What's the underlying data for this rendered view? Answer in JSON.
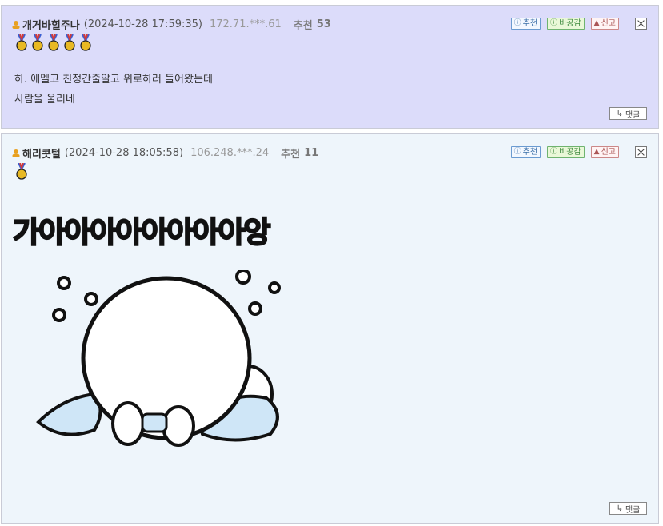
{
  "comments": [
    {
      "nickname": "개거바힐주나",
      "date": "(2024-10-28 17:59:35)",
      "ip": "172.71.***.61",
      "recommend_label": "추천",
      "recommend_count": "53",
      "medal_count": 5,
      "lines": [
        "하. 애멜고 친정간줄알고 위로하러 들어왔는데",
        "사람을 울리네"
      ],
      "buttons": {
        "recommend": "추천",
        "nonrecommend": "비공감",
        "report": "신고"
      },
      "reply_label": "댓글"
    },
    {
      "nickname": "해리콧털",
      "date": "(2024-10-28 18:05:58)",
      "ip": "106.248.***.24",
      "recommend_label": "추천",
      "recommend_count": "11",
      "medal_count": 1,
      "shout_text": "가아아아아아아아아앙",
      "buttons": {
        "recommend": "추천",
        "nonrecommend": "비공감",
        "report": "신고"
      },
      "reply_label": "댓글"
    }
  ],
  "colors": {
    "comment1_bg": "#dcdcfa",
    "comment2_bg": "#eef5fb",
    "medal_gold": "#e8b923",
    "ribbon_red": "#d23a3a",
    "ribbon_blue": "#3a5fd2"
  },
  "icons": {
    "nickname_icon": "user-badge-icon",
    "medal_icon": "gold-medal-icon",
    "recommend_icon": "info-circle-icon",
    "report_icon": "siren-icon",
    "reply_icon": "reply-arrow-icon",
    "close_icon": "close-x-icon"
  }
}
